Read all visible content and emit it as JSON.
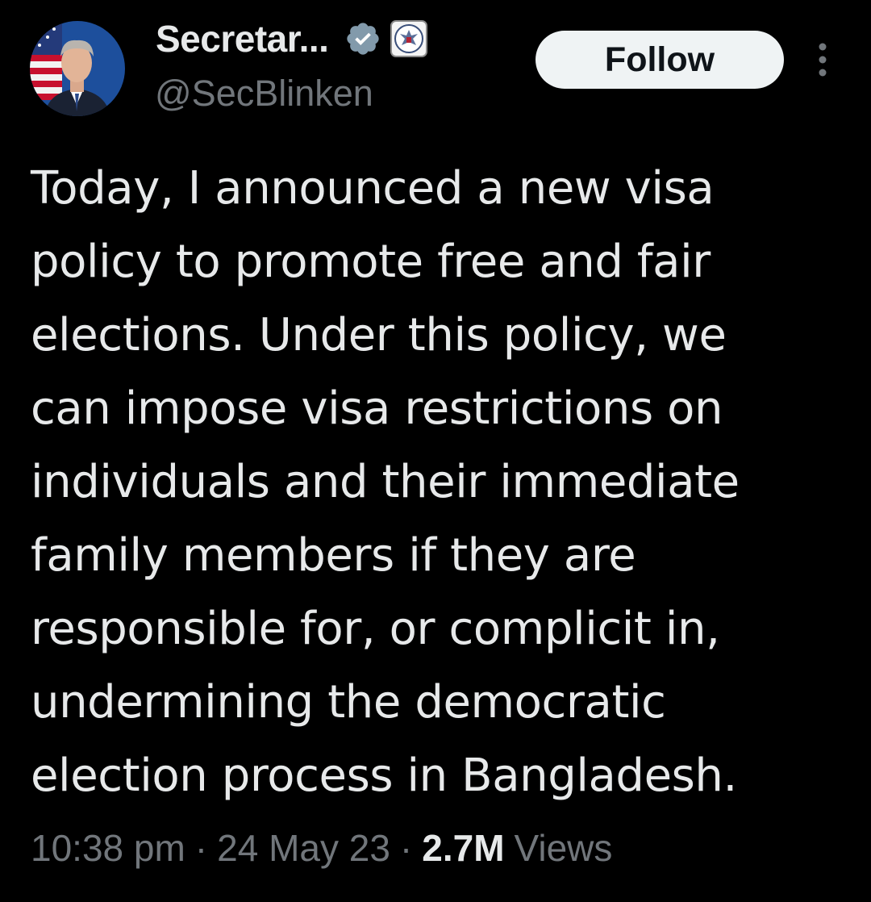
{
  "author": {
    "display_name": "Secretar...",
    "handle": "@SecBlinken",
    "verified_badge_icon": "verified-badge-icon",
    "affiliation_icon": "state-department-seal-icon"
  },
  "actions": {
    "follow_label": "Follow",
    "more_icon": "more-vertical-icon"
  },
  "tweet": {
    "text_lines": [
      "Today, I announced a new visa",
      "policy to promote free and fair",
      "elections. Under this policy, we",
      "can impose visa restrictions on",
      "individuals and their immediate",
      "family members if they are",
      "responsible for, or complicit in,",
      "undermining the democratic",
      "election process in Bangladesh."
    ]
  },
  "meta": {
    "time": "10:38 pm",
    "separator": "·",
    "date": "24 May 23",
    "views_count": "2.7M",
    "views_label": "Views"
  },
  "colors": {
    "background": "#000000",
    "primary_text": "#e7e9ea",
    "secondary_text": "#71767b",
    "follow_bg": "#eff3f4",
    "follow_text": "#0f1419",
    "badge": "#829aab"
  }
}
